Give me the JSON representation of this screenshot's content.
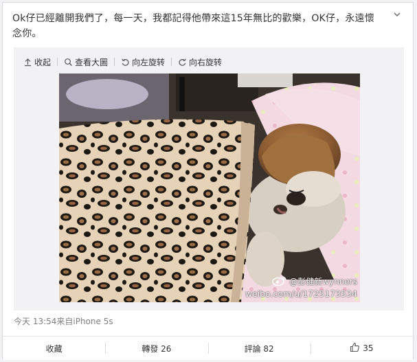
{
  "post": {
    "text": "Ok仔已經離開我們了，每一天，我都記得他帶來這15年無比的歡樂，OK仔，永遠懷念你。"
  },
  "media": {
    "toolbar": {
      "collapse": "收起",
      "view_large": "查看大圖",
      "rotate_left": "向左旋转",
      "rotate_right": "向右旋转"
    },
    "watermark": {
      "handle": "@彭健新wynners",
      "url": "weibo.com/u/1725173534"
    }
  },
  "meta": {
    "time_source": "今天 13:54来自iPhone 5s"
  },
  "actions": {
    "favorite": "收藏",
    "repost": "轉發 26",
    "comment": "評論 82",
    "like_count": "35"
  },
  "icons": {
    "caret": "chevron-down-icon",
    "collapse": "arrow-up-icon",
    "view_large": "magnifier-icon",
    "rotate_left": "rotate-left-icon",
    "rotate_right": "rotate-right-icon",
    "like": "thumbs-up-icon",
    "watermark_logo": "weibo-logo-icon"
  },
  "colors": {
    "text": "#333333",
    "meta": "#808080",
    "media_bg": "#f2f2f5"
  }
}
